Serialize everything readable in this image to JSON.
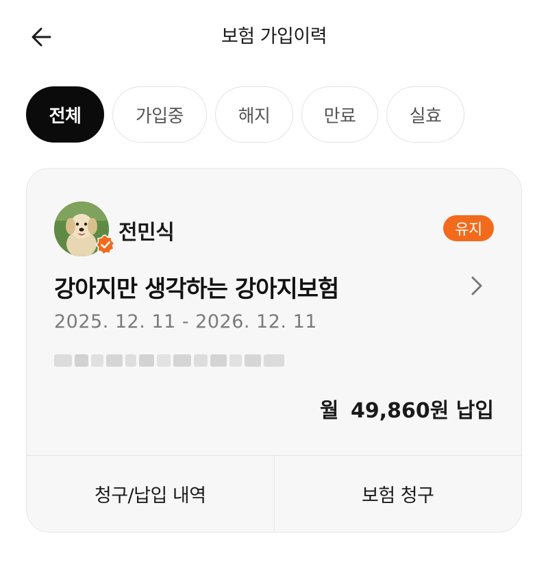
{
  "header": {
    "title": "보험 가입이력",
    "back_icon": "arrow-left-icon"
  },
  "filters": [
    {
      "label": "전체",
      "active": true
    },
    {
      "label": "가입중",
      "active": false
    },
    {
      "label": "해지",
      "active": false
    },
    {
      "label": "만료",
      "active": false
    },
    {
      "label": "실효",
      "active": false
    }
  ],
  "card": {
    "owner_name": "전민식",
    "status": "유지",
    "product_name": "강아지만 생각하는 강아지보험",
    "period": "2025. 12. 11 - 2026. 12. 11",
    "premium_prefix": "월",
    "premium_amount": "49,860원 납입",
    "actions": [
      "청구/납입 내역",
      "보험 청구"
    ]
  },
  "colors": {
    "accent": "#f26b1d",
    "active_chip": "#0b0b0b",
    "card_bg": "#f7f7f7"
  }
}
